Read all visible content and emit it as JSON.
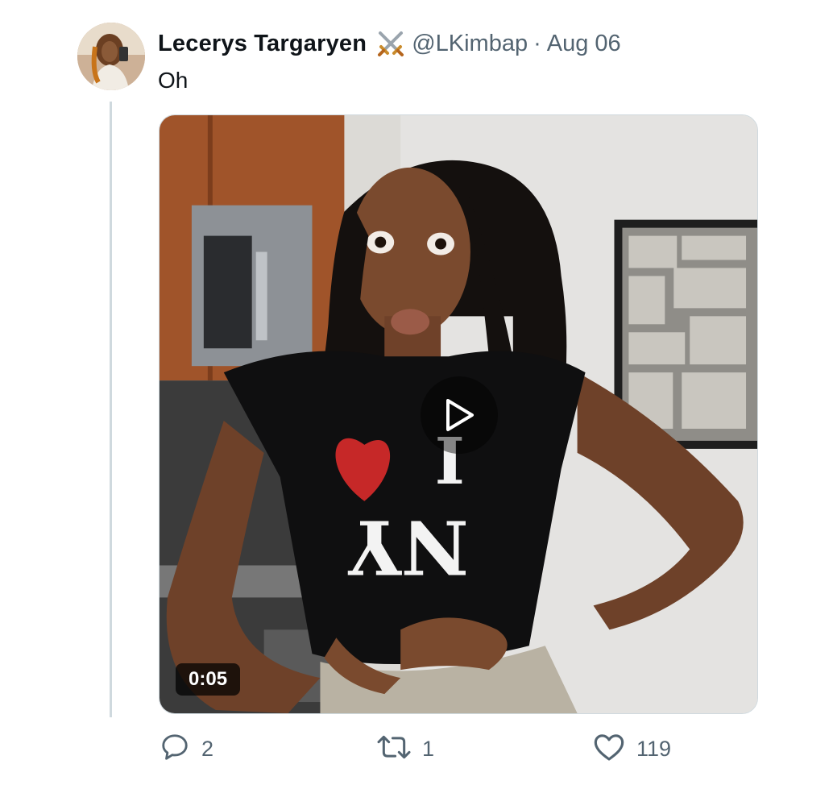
{
  "tweet": {
    "display_name": "Lecerys Targaryen",
    "badge_icon": "crossed-swords-icon",
    "handle": "@LKimbap",
    "separator": "·",
    "date": "Aug 06",
    "text": "Oh"
  },
  "media": {
    "type": "video",
    "duration": "0:05",
    "shirt_text": "I ♥ NY"
  },
  "actions": {
    "reply_count": "2",
    "retweet_count": "1",
    "like_count": "119"
  },
  "colors": {
    "text_primary": "#0f1419",
    "text_secondary": "#536471",
    "border": "#cfd9de"
  }
}
